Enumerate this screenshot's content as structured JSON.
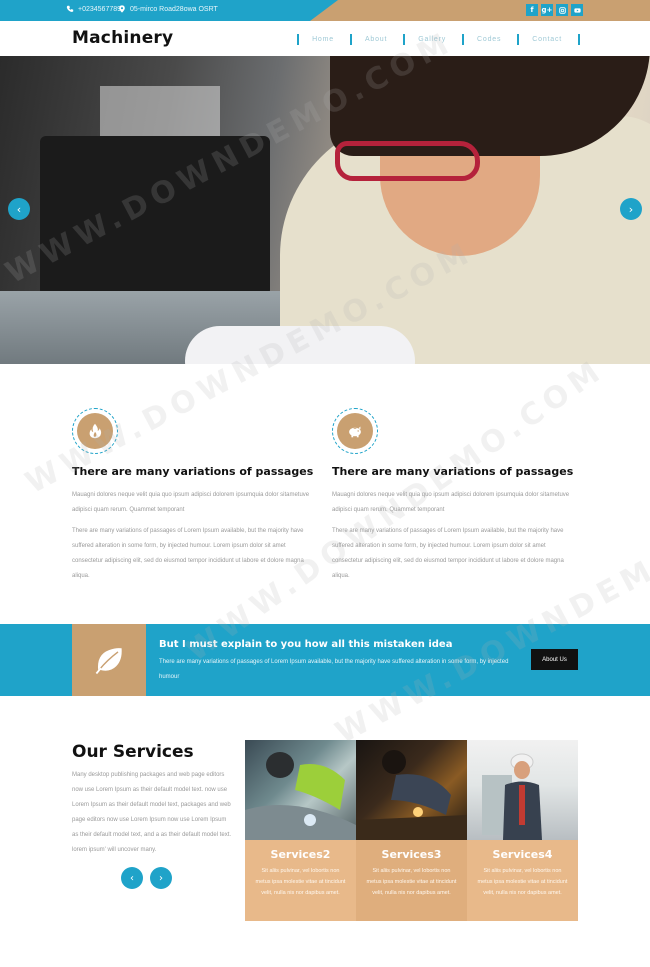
{
  "topbar": {
    "phone": "+0234567789",
    "address": "05-mirco Road28owa OSRT",
    "social": [
      "f",
      "g+",
      "ig",
      "yt"
    ]
  },
  "header": {
    "logo": "Machinery",
    "nav": [
      "Home",
      "About",
      "Gallery",
      "Codes",
      "Contact"
    ]
  },
  "hero": {
    "prev_arrow": "‹",
    "next_arrow": "›"
  },
  "features": [
    {
      "icon": "fire-icon",
      "title": "There are many variations of passages",
      "p1": "Mauagni dolores neque velit quia quo ipsum adipisci dolorem ipsumquia dolor sitametuve adipisci quam rerum. Quammet temporant",
      "p2": "There are many variations of passages of Lorem Ipsum available, but the majority have suffered alteration in some form, by injected humour. Lorem ipsum dolor sit amet consectetur adipiscing elit, sed do eiusmod tempor incididunt ut labore et dolore magna aliqua."
    },
    {
      "icon": "piggy-bank-icon",
      "title": "There are many variations of passages",
      "p1": "Mauagni dolores neque velit quia quo ipsum adipisci dolorem ipsumquia dolor sitametuve adipisci quam rerum. Quammet temporant",
      "p2": "There are many variations of passages of Lorem Ipsum available, but the majority have suffered alteration in some form, by injected humour. Lorem ipsum dolor sit amet consectetur adipiscing elit, sed do eiusmod tempor incididunt ut labore et dolore magna aliqua."
    }
  ],
  "banner": {
    "title": "But I must explain to you how all this mistaken idea",
    "text": "There are many variations of passages of Lorem Ipsum available, but the majority have suffered alteration in some form, by injected humour",
    "button": "About Us"
  },
  "services": {
    "title": "Our Services",
    "text": "Many desktop publishing packages and web page editors now use Lorem Ipsum as their default model text. now use Lorem Ipsum as their default model text, packages and web page editors now use Lorem Ipsum now use Lorem Ipsum as their default model text, and a as their default model text. lorem ipsum' will uncover many.",
    "prev": "‹",
    "next": "›",
    "cards": [
      {
        "title": "Services2",
        "text": "Sit aliis pulvinar, vel lobortis non metus ipsa molestie vitae at tincidunt velit, nulla nis nor dapibus amet."
      },
      {
        "title": "Services3",
        "text": "Sit aliis pulvinar, vel lobortis non metus ipsa molestie vitae at tincidunt velit, nulla nis nor dapibus amet."
      },
      {
        "title": "Services4",
        "text": "Sit aliis pulvinar, vel lobortis non metus ipsa molestie vitae at tincidunt velit, nulla nis nor dapibus amet."
      }
    ]
  },
  "watermark": "WWW.DOWNDEMO.COM",
  "colors": {
    "blue": "#1fa3c9",
    "tan": "#c9a071"
  }
}
